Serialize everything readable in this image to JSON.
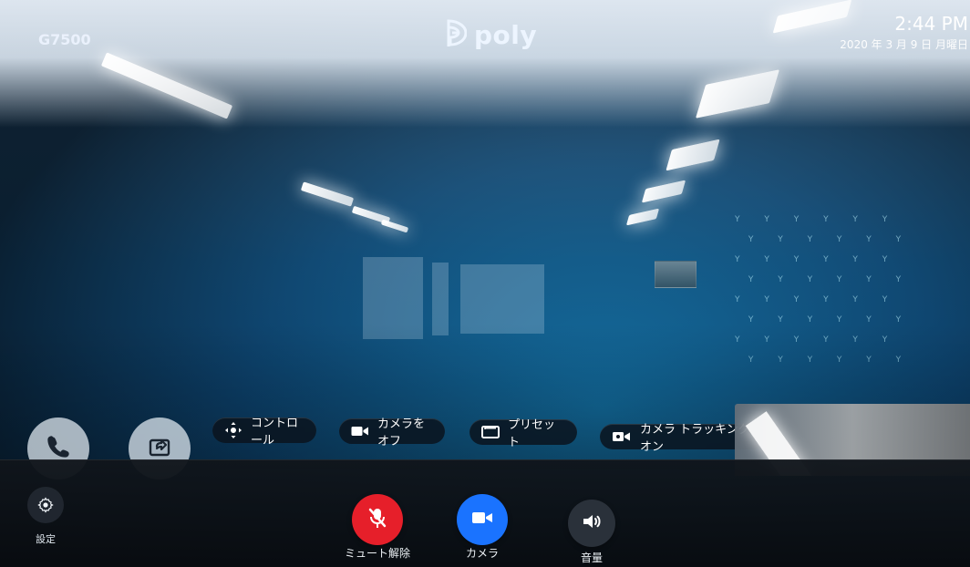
{
  "top": {
    "device_name": "G7500",
    "brand": "poly",
    "time": "2:44 PM",
    "date": "2020 年 3 月 9 日 月曜日"
  },
  "quick_actions": {
    "control": "コントロール",
    "camera_off": "カメラをオフ",
    "preset": "プリセット",
    "camera_tracking": "カメラ トラッキング オン"
  },
  "bottom_bar": {
    "settings_label": "設定",
    "mute_label": "ミュート解除",
    "camera_label": "カメラ",
    "volume_label": "音量"
  },
  "icons": {
    "phone": "phone-icon",
    "share": "share-icon",
    "control": "move-control-icon",
    "camera_off": "camera-icon",
    "preset": "preset-icon",
    "camera_tracking": "camera-tracking-icon",
    "settings": "gear-icon",
    "mute": "mic-muted-icon",
    "camera": "video-camera-icon",
    "volume": "volume-icon"
  },
  "colors": {
    "mute_button": "#e61f2a",
    "camera_button": "#1a73ff",
    "volume_button": "#2a313a",
    "chip_bg": "#0d1520",
    "overlay_bar": "#11161c"
  }
}
